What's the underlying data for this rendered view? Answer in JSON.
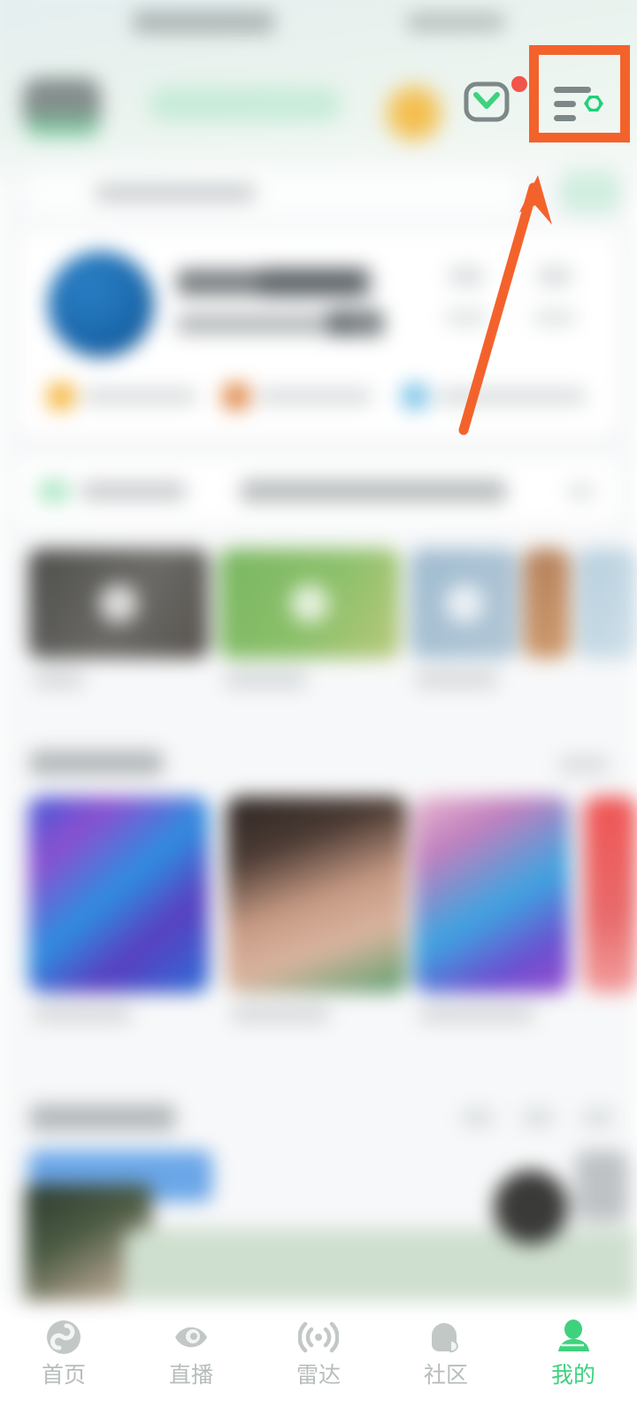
{
  "app": {
    "screen_name": "profile-home",
    "accent_green": "#3ed27f",
    "highlight_orange": "#f4622c",
    "notification_red": "#f2544a",
    "surface_bg": "#f7f8f9",
    "header_bg": "#e9f2ee"
  },
  "annotation": {
    "type": "highlight-box-with-arrow",
    "target": "menu-settings-icon",
    "box_color": "#f4622c",
    "arrow_color": "#f4622c"
  },
  "header": {
    "mail_icon": "envelope-icon",
    "mail_has_unread": true,
    "menu_icon": "menu-settings-icon",
    "sun_icon": "sun-icon",
    "avatar_icon": "avatar-chip"
  },
  "search": {
    "placeholder": "",
    "icon": "search-icon"
  },
  "profile_card": {
    "avatar": "user-avatar",
    "name": "",
    "subtitle": "",
    "stats": [
      {
        "value": "",
        "label": ""
      },
      {
        "value": "",
        "label": ""
      }
    ],
    "tags": [
      {
        "color": "#f5b63f",
        "label": ""
      },
      {
        "color": "#e08a4a",
        "label": ""
      },
      {
        "color": "#7fc5e8",
        "label": ""
      }
    ]
  },
  "notice": {
    "badge": "",
    "title": "",
    "text": "",
    "action": ""
  },
  "video_section": {
    "cards": [
      {
        "color": "#5a5a58",
        "label": ""
      },
      {
        "color": "#7cb563",
        "label": ""
      },
      {
        "color": "#9ab8cf",
        "label": ""
      },
      {
        "color": "#bcd0dc",
        "label": ""
      }
    ]
  },
  "poster_section": {
    "heading": "",
    "more": "",
    "cards": [
      {
        "label": ""
      },
      {
        "label": ""
      },
      {
        "label": ""
      },
      {
        "label": ""
      }
    ]
  },
  "bottom_section": {
    "heading": "",
    "icons": [
      "",
      "",
      ""
    ]
  },
  "tabbar": {
    "items": [
      {
        "label": "首页",
        "icon": "home-icon",
        "active": false
      },
      {
        "label": "直播",
        "icon": "live-eye-icon",
        "active": false
      },
      {
        "label": "雷达",
        "icon": "radar-icon",
        "active": false
      },
      {
        "label": "社区",
        "icon": "community-icon",
        "active": false
      },
      {
        "label": "我的",
        "icon": "profile-icon",
        "active": true
      }
    ]
  }
}
